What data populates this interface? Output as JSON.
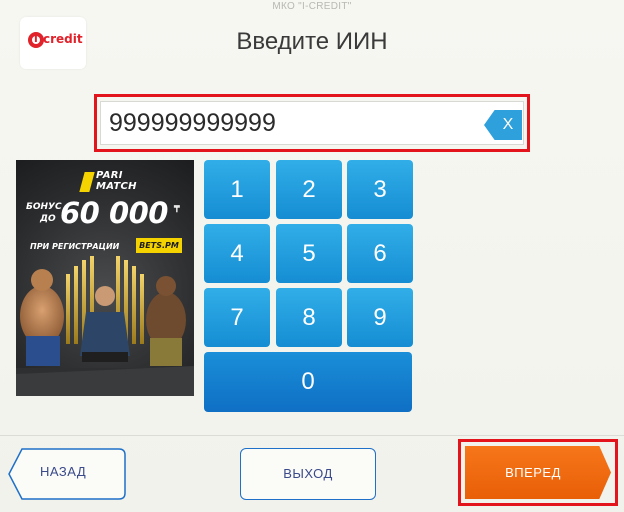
{
  "header": {
    "org_name": "МКО \"I-CREDIT\"",
    "logo_text": "credit",
    "logo_letter": "i",
    "title": "Введите ИИН"
  },
  "iin_field": {
    "value": "999999999999",
    "clear_label": "X"
  },
  "ad": {
    "brand_line1": "PARI",
    "brand_line2": "MATCH",
    "bonus_line1": "БОНУС",
    "bonus_line2": "ДО",
    "amount": "60 000",
    "currency": "₸",
    "registration": "ПРИ РЕГИСТРАЦИИ",
    "site": "BETS.PM"
  },
  "keypad": {
    "keys": [
      "1",
      "2",
      "3",
      "4",
      "5",
      "6",
      "7",
      "8",
      "9"
    ],
    "zero": "0"
  },
  "footer": {
    "back_label": "НАЗАД",
    "exit_label": "ВЫХОД",
    "next_label": "ВПЕРЕД"
  },
  "colors": {
    "key_blue": "#1a9ee0",
    "highlight_red": "#e3141c",
    "next_orange": "#f26b0f",
    "brand_red": "#e1222b"
  }
}
